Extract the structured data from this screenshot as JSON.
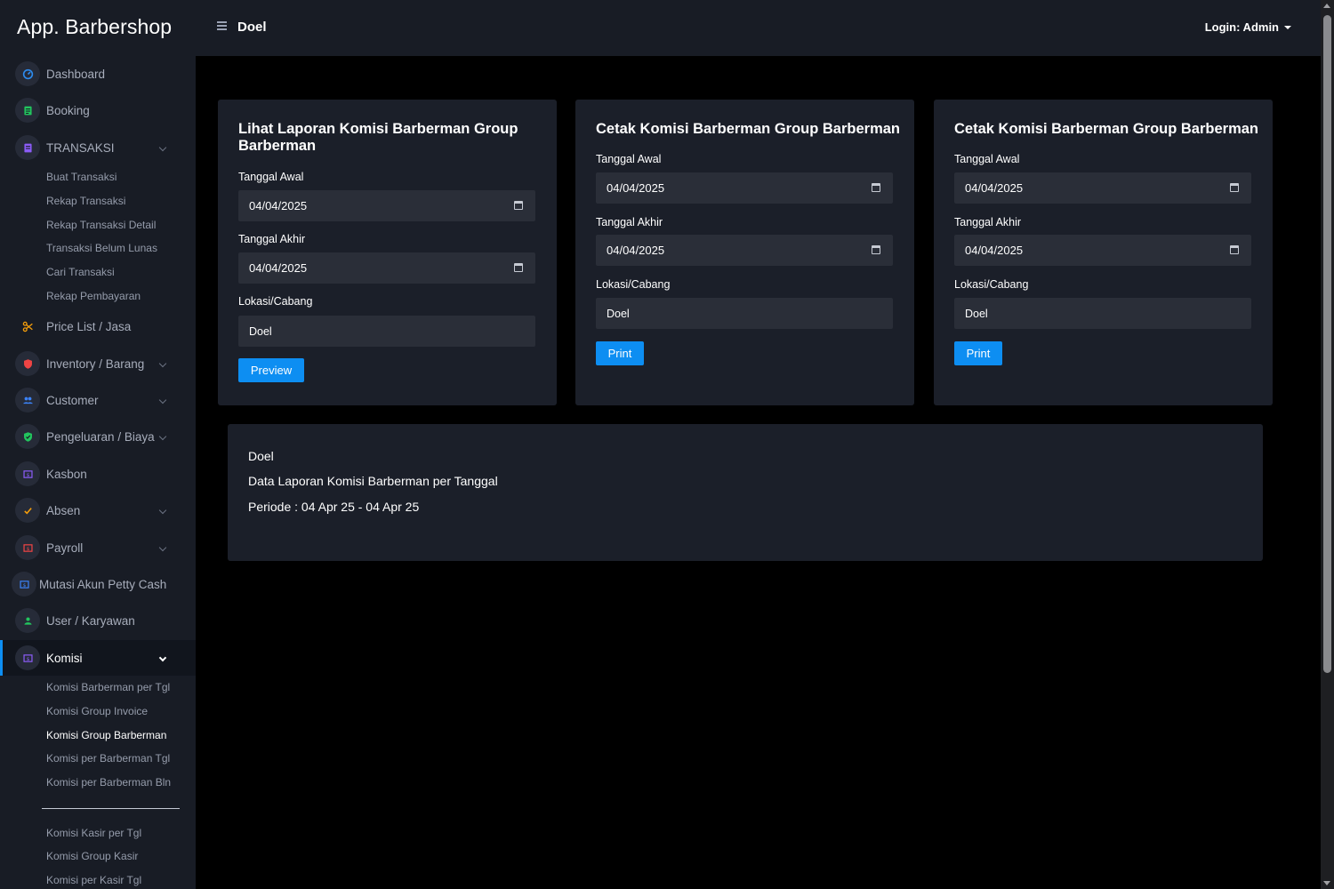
{
  "app": {
    "brand": "App. Barbershop",
    "page_title": "Doel",
    "login": "Login: Admin"
  },
  "sidebar": {
    "items": [
      {
        "label": "Dashboard",
        "icon": "gauge-icon",
        "color": "#2d8cf0"
      },
      {
        "label": "Booking",
        "icon": "list-icon",
        "color": "#22c55e"
      },
      {
        "label": "TRANSAKSI",
        "icon": "document-icon",
        "color": "#8b5cf6"
      },
      {
        "label": "Price List / Jasa",
        "icon": "scissors-icon",
        "color": "#f59e0b"
      },
      {
        "label": "Inventory / Barang",
        "icon": "shield-icon",
        "color": "#ef4444"
      },
      {
        "label": "Customer",
        "icon": "users-icon",
        "color": "#3b82f6"
      },
      {
        "label": "Pengeluaran / Biaya",
        "icon": "shield-check-icon",
        "color": "#22c55e"
      },
      {
        "label": "Kasbon",
        "icon": "money-icon",
        "color": "#8b5cf6"
      },
      {
        "label": "Absen",
        "icon": "check-icon",
        "color": "#f59e0b"
      },
      {
        "label": "Payroll",
        "icon": "money-icon",
        "color": "#ef4444"
      },
      {
        "label": "Mutasi Akun Petty Cash",
        "icon": "money-icon",
        "color": "#3b82f6"
      },
      {
        "label": "User / Karyawan",
        "icon": "user-icon",
        "color": "#22c55e"
      },
      {
        "label": "Komisi",
        "icon": "money-icon",
        "color": "#8b5cf6"
      }
    ],
    "transaksi_sub": [
      "Buat Transaksi",
      "Rekap Transaksi",
      "Rekap Transaksi Detail",
      "Transaksi Belum Lunas",
      "Cari Transaksi",
      "Rekap Pembayaran"
    ],
    "komisi_sub": [
      "Komisi Barberman per Tgl",
      "Komisi Group Invoice",
      "Komisi Group Barberman",
      "Komisi per Barberman Tgl",
      "Komisi per Barberman Bln"
    ],
    "komisi_sub2": [
      "Komisi Kasir per Tgl",
      "Komisi Group Kasir",
      "Komisi per Kasir Tgl"
    ]
  },
  "cards": [
    {
      "title": "Lihat Laporan Komisi Barberman Group Barberman",
      "start_label": "Tanggal Awal",
      "start_value": "04/04/2025",
      "end_label": "Tanggal Akhir",
      "end_value": "04/04/2025",
      "location_label": "Lokasi/Cabang",
      "location_value": "Doel",
      "button": "Preview"
    },
    {
      "title": "Cetak Komisi Barberman Group Barberman",
      "start_label": "Tanggal Awal",
      "start_value": "04/04/2025",
      "end_label": "Tanggal Akhir",
      "end_value": "04/04/2025",
      "location_label": "Lokasi/Cabang",
      "location_value": "Doel",
      "button": "Print"
    },
    {
      "title": "Cetak Komisi Barberman Group Barberman",
      "start_label": "Tanggal Awal",
      "start_value": "04/04/2025",
      "end_label": "Tanggal Akhir",
      "end_value": "04/04/2025",
      "location_label": "Lokasi/Cabang",
      "location_value": "Doel",
      "button": "Print"
    }
  ],
  "report": {
    "location": "Doel",
    "title": "Data Laporan Komisi Barberman per Tanggal",
    "period": "Periode : 04 Apr 25 - 04 Apr 25"
  }
}
